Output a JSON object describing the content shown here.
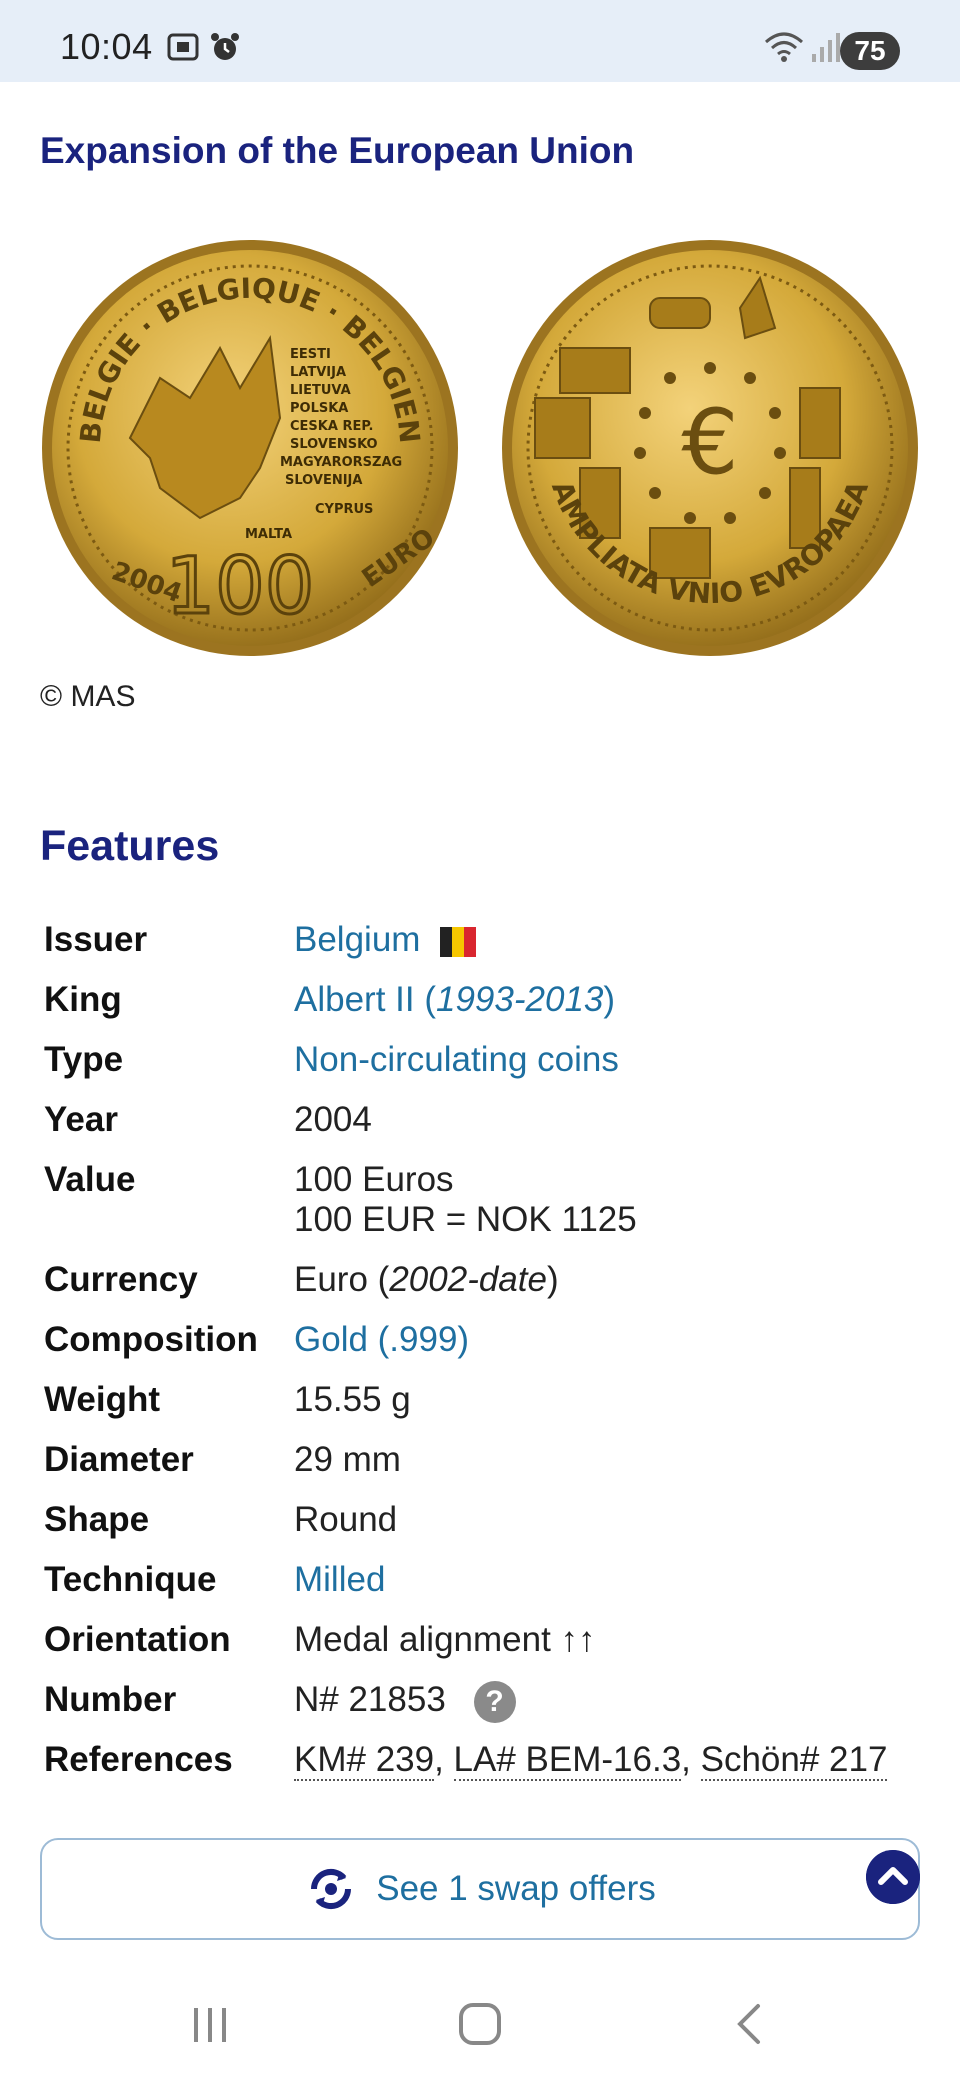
{
  "status_bar": {
    "time": "10:04",
    "battery": "75",
    "icons": [
      "screenshot-icon",
      "alarm-icon",
      "wifi-icon",
      "signal-icon"
    ]
  },
  "page_title": "Expansion of the European Union",
  "images": {
    "obverse": {
      "top_text": "BELGIE · BELGIQUE · BELGIEN",
      "countries": [
        "EESTI",
        "LATVIJA",
        "LIETUVA",
        "POLSKA",
        "CESKA REP.",
        "SLOVENSKO",
        "MAGYARORSZAG",
        "SLOVENIJA",
        "CYPRUS",
        "MALTA"
      ],
      "year": "2004",
      "value": "100",
      "unit": "EURO"
    },
    "reverse": {
      "legend": "AMPLIATA VNIO EVROPAEA",
      "symbol": "€"
    },
    "credit": "© MAS"
  },
  "features": {
    "heading": "Features",
    "issuer": {
      "label": "Issuer",
      "value": "Belgium"
    },
    "king": {
      "label": "King",
      "name": "Albert II",
      "open": "(",
      "years": "1993-2013",
      "close": ")"
    },
    "type": {
      "label": "Type",
      "value": "Non-circulating coins"
    },
    "year": {
      "label": "Year",
      "value": "2004"
    },
    "value": {
      "label": "Value",
      "line1": "100 Euros",
      "line2": "100 EUR = NOK 1125"
    },
    "currency": {
      "label": "Currency",
      "name": "Euro",
      "open": "(",
      "years": "2002-date",
      "close": ")"
    },
    "composition": {
      "label": "Composition",
      "value": "Gold (.999)"
    },
    "weight": {
      "label": "Weight",
      "value": "15.55 g"
    },
    "diameter": {
      "label": "Diameter",
      "value": "29 mm"
    },
    "shape": {
      "label": "Shape",
      "value": "Round"
    },
    "technique": {
      "label": "Technique",
      "value": "Milled"
    },
    "orientation": {
      "label": "Orientation",
      "value": "Medal alignment ↑↑"
    },
    "number": {
      "label": "Number",
      "value": "N# 21853",
      "help": "?"
    },
    "references": {
      "label": "References",
      "km": "KM# 239",
      "sep1": ", ",
      "la": "LA# BEM-16.3",
      "sep2": ", ",
      "schon": "Schön# 217"
    }
  },
  "swap_button": {
    "label": "See 1 swap offers"
  },
  "colors": {
    "heading": "#1a237e",
    "link": "#1e6fa0",
    "gold": "#d4a93a"
  }
}
